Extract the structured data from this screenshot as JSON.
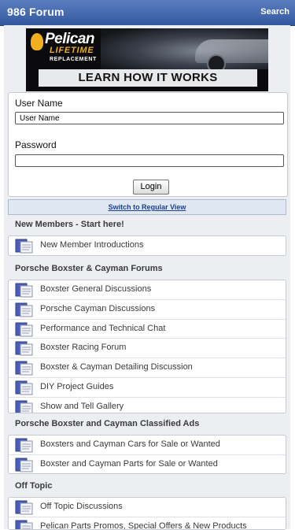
{
  "header": {
    "title": "986 Forum",
    "search_label": "Search"
  },
  "ad": {
    "brand": "Pelican",
    "tagline": "LIFETIME",
    "subline": "REPLACEMENT",
    "banner": "LEARN HOW IT WORKS"
  },
  "login": {
    "username_label": "User Name",
    "username_value": "User Name",
    "password_label": "Password",
    "password_value": "",
    "button_label": "Login"
  },
  "switch_view_label": "Switch to Regular View",
  "sections": [
    {
      "title": "New Members - Start here!",
      "items": [
        "New Member Introductions"
      ]
    },
    {
      "title": "Porsche Boxster & Cayman Forums",
      "items": [
        "Boxster General Discussions",
        "Porsche Cayman Discussions",
        "Performance and Technical Chat",
        "Boxster Racing Forum",
        "Boxster & Cayman Detailing Discussion",
        "DIY Project Guides",
        "Show and Tell Gallery"
      ]
    },
    {
      "title": "Porsche Boxster and Cayman Classified Ads",
      "items": [
        "Boxsters and Cayman Cars for Sale or Wanted",
        "Boxster and Cayman Parts for Sale or Wanted"
      ]
    },
    {
      "title": "Off Topic",
      "items": [
        "Off Topic Discussions",
        "Pelican Parts Promos, Special Offers & New Products"
      ]
    }
  ],
  "colors": {
    "header_bg": "#3f64aa",
    "link": "#1c3f8f",
    "icon": "#5a6ec0"
  }
}
